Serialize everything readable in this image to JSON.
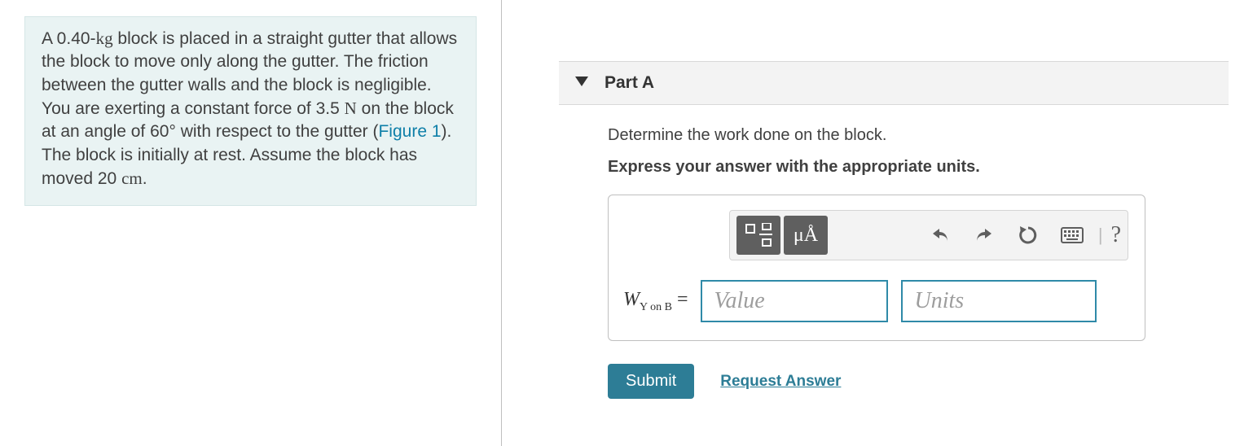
{
  "problem": {
    "text_prefix": "A 0.40-",
    "unit_kg": "kg",
    "text_mid1": " block is placed in a straight gutter that allows the block to move only along the gutter. The friction between the gutter walls and the block is negligible. You are exerting a constant force of 3.5 ",
    "unit_N": "N",
    "text_mid2": " on the block at an angle of 60° with respect to the gutter (",
    "figure_label": "Figure 1",
    "text_mid3": "). The block is initially at rest. Assume the block has moved 20 ",
    "unit_cm": "cm",
    "text_end": "."
  },
  "part": {
    "label": "Part A",
    "prompt": "Determine the work done on the block.",
    "instruction": "Express your answer with the appropriate units."
  },
  "answer": {
    "variable_main": "W",
    "variable_sub": "Y on B",
    "equals": "=",
    "value_placeholder": "Value",
    "units_placeholder": "Units"
  },
  "toolbar": {
    "templates_icon": "fraction-template-icon",
    "units_icon_text": "μÅ",
    "undo": "↶",
    "redo": "↷",
    "reset": "↻",
    "keyboard": "⌨",
    "help": "?"
  },
  "actions": {
    "submit": "Submit",
    "request": "Request Answer"
  }
}
